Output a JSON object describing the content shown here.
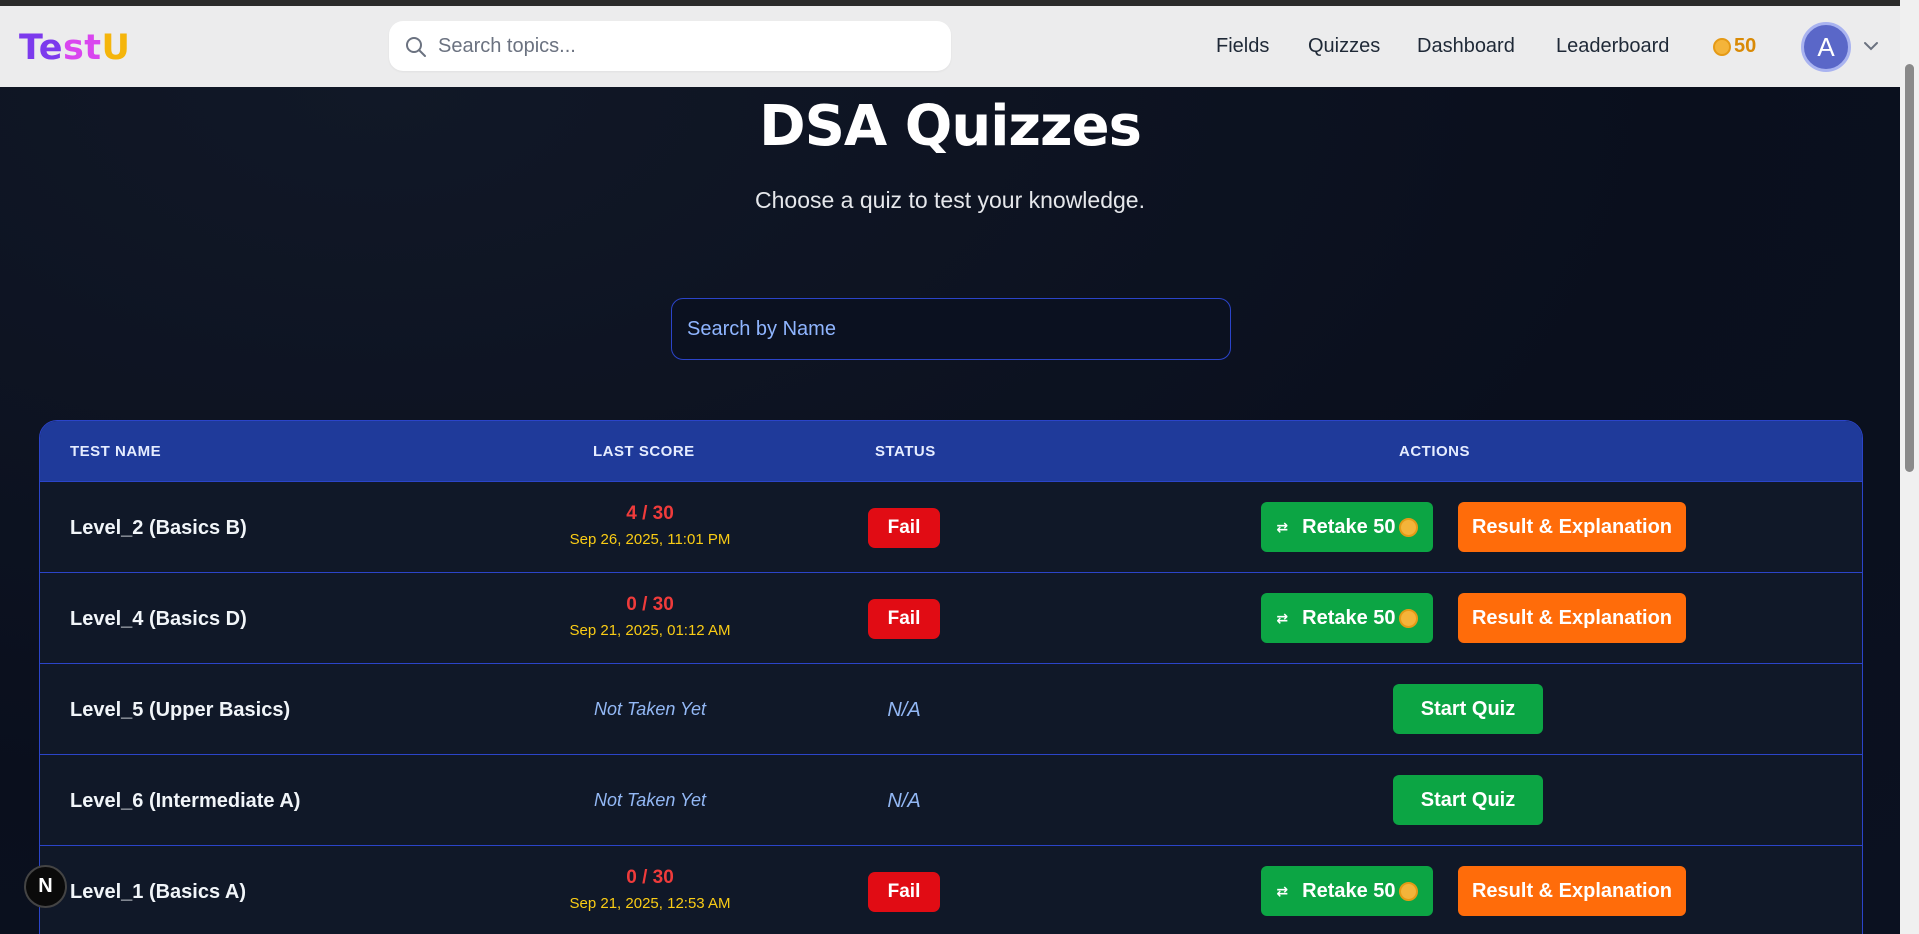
{
  "brand": {
    "part1": "Te",
    "part2": "st",
    "part3": "U"
  },
  "top_search": {
    "placeholder": "Search topics..."
  },
  "nav": {
    "links": [
      "Fields",
      "Quizzes",
      "Dashboard",
      "Leaderboard"
    ]
  },
  "coins": {
    "count": "50"
  },
  "user": {
    "avatar_letter": "A"
  },
  "page": {
    "title": "DSA Quizzes",
    "subtitle": "Choose a quiz to test your knowledge."
  },
  "name_search": {
    "placeholder": "Search by Name"
  },
  "table": {
    "headers": [
      "TEST NAME",
      "LAST SCORE",
      "STATUS",
      "ACTIONS"
    ],
    "rows": [
      {
        "name": "Level_2 (Basics B)",
        "score": "4 / 30",
        "date": "Sep 26, 2025, 11:01 PM",
        "status": "Fail",
        "retake": "Retake 50",
        "result": "Result & Explanation"
      },
      {
        "name": "Level_4 (Basics D)",
        "score": "0 / 30",
        "date": "Sep 21, 2025, 01:12 AM",
        "status": "Fail",
        "retake": "Retake 50",
        "result": "Result & Explanation"
      },
      {
        "name": "Level_5 (Upper Basics)",
        "score": "Not Taken Yet",
        "status": "N/A",
        "start": "Start Quiz"
      },
      {
        "name": "Level_6 (Intermediate A)",
        "score": "Not Taken Yet",
        "status": "N/A",
        "start": "Start Quiz"
      },
      {
        "name": "Level_1 (Basics A)",
        "score": "0 / 30",
        "date": "Sep 21, 2025, 12:53 AM",
        "status": "Fail",
        "retake": "Retake 50",
        "result": "Result & Explanation"
      }
    ]
  },
  "dev_badge": {
    "label": "N"
  },
  "colors": {
    "accent_blue": "#1f3a9a",
    "fail_red": "#e10c14",
    "retake_green": "#0ca544",
    "result_orange": "#ff6c0a",
    "coin_gold": "#d98a06"
  }
}
